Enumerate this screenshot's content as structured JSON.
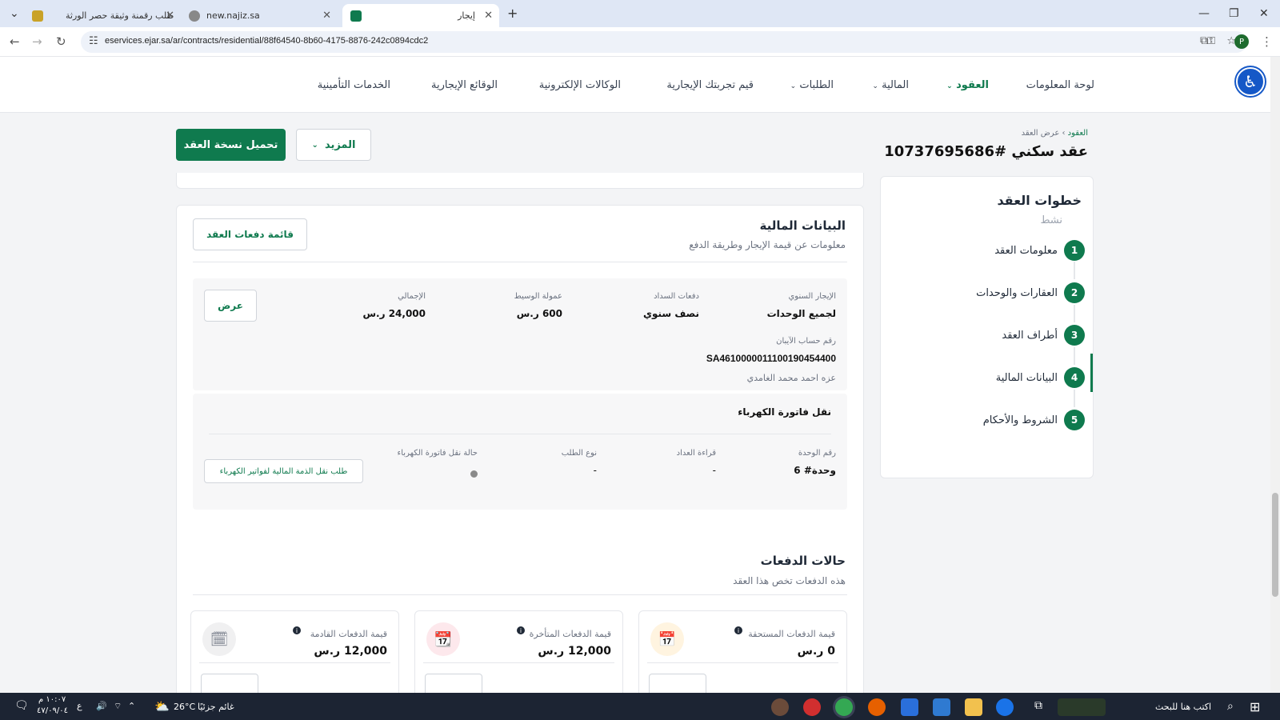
{
  "browser": {
    "tabs": [
      {
        "title": "طلب رقمنة وثيقة حصر الورثة"
      },
      {
        "title": "new.najiz.sa"
      },
      {
        "title": "إيجار"
      }
    ],
    "url": "eservices.ejar.sa/ar/contracts/residential/88f64540-8b60-4175-8876-242c0894cdc2",
    "profile_initial": "P"
  },
  "topnav": {
    "items": [
      "لوحة المعلومات",
      "العقود",
      "المالية",
      "الطلبات",
      "قيم تجربتك الإيجارية",
      "الوكالات الإلكترونية",
      "الوقائع الإيجارية",
      "الخدمات التأمينية"
    ]
  },
  "header": {
    "breadcrumb_root": "العقود",
    "breadcrumb_sep": "›",
    "breadcrumb_current": "عرض العقد",
    "title": "عقد سكني #10737695686",
    "download_label": "تحميل نسخة العقد",
    "more_label": "المزيد"
  },
  "steps": {
    "title": "خطوات العقد",
    "status": "نشط",
    "items": [
      {
        "num": "1",
        "label": "معلومات العقد"
      },
      {
        "num": "2",
        "label": "العقارات والوحدات"
      },
      {
        "num": "3",
        "label": "أطراف العقد"
      },
      {
        "num": "4",
        "label": "البيانات المالية"
      },
      {
        "num": "5",
        "label": "الشروط والأحكام"
      }
    ]
  },
  "financial": {
    "title": "البيانات المالية",
    "subtitle": "معلومات عن قيمة الإيجار وطريقة الدفع",
    "payments_list_label": "قائمة دفعات العقد",
    "annual_rent_label": "الإيجار السنوي",
    "annual_rent_value": "لجميع الوحدات",
    "payment_schedule_label": "دفعات السداد",
    "payment_schedule_value": "نصف سنوي",
    "broker_fee_label": "عمولة الوسيط",
    "broker_fee_value": "600 ر.س",
    "total_label": "الإجمالي",
    "total_value": "24,000 ر.س",
    "view_label": "عرض",
    "iban_label": "رقم حساب الآيبان",
    "iban_value": "SA4610000011100190454400",
    "iban_holder": "عزه احمد محمد الغامدي"
  },
  "electricity": {
    "title": "نقل فاتورة الكهرباء",
    "unit_label": "رقم الوحدة",
    "unit_value": "وحدة# 6",
    "meter_label": "قراءة العداد",
    "meter_value": "-",
    "request_type_label": "نوع الطلب",
    "request_type_value": "-",
    "status_label": "حالة نقل فاتورة الكهرباء",
    "transfer_button": "طلب نقل الذمة المالية لفواتير الكهرباء"
  },
  "payment_status": {
    "title": "حالات الدفعات",
    "subtitle": "هذه الدفعات تخص هذا العقد",
    "cards": [
      {
        "label": "قيمة الدفعات المستحقة",
        "value": "0 ر.س",
        "color": "#f59e0b"
      },
      {
        "label": "قيمة الدفعات المتأخرة",
        "value": "12,000 ر.س",
        "color": "#e11d48"
      },
      {
        "label": "قيمة الدفعات القادمة",
        "value": "12,000 ر.س",
        "color": "#6b7280"
      }
    ]
  },
  "taskbar": {
    "search_placeholder": "اكتب هنا للبحث",
    "weather": "26°C",
    "weather_text": "غائم جزئيًا",
    "lang": "ع",
    "time": "١٠:٠٧ م",
    "date": "٤٧/٠٩/٠٤"
  }
}
